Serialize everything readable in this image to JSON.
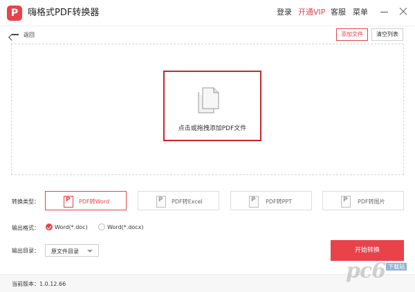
{
  "app": {
    "title": "嗨格式PDF转换器",
    "logo_letter": "P"
  },
  "topnav": {
    "login": "登录",
    "vip": "开通VIP",
    "service": "客服",
    "menu": "菜单"
  },
  "toolbar": {
    "back": "返回",
    "add_file": "添加文件",
    "clear_list": "清空列表"
  },
  "dropzone": {
    "text": "点击或拖拽添加PDF文件"
  },
  "conversion": {
    "label": "转换类型：",
    "types": [
      {
        "label": "PDF转Word",
        "active": true
      },
      {
        "label": "PDF转Excel",
        "active": false
      },
      {
        "label": "PDF转PPT",
        "active": false
      },
      {
        "label": "PDF转图片",
        "active": false
      }
    ]
  },
  "output_format": {
    "label": "输出格式：",
    "options": [
      {
        "label": "Word(*.doc)",
        "checked": true
      },
      {
        "label": "Word(*.docx)",
        "checked": false
      }
    ]
  },
  "output_dir": {
    "label": "输出目录：",
    "selected": "原文件目录"
  },
  "start_button": "开始转换",
  "status": {
    "version": "当前版本：1.0.12.66"
  },
  "watermark": {
    "text": "pc6",
    "sub": "下载站"
  },
  "colors": {
    "accent": "#e8424a",
    "highlight_border": "#c9232a"
  }
}
